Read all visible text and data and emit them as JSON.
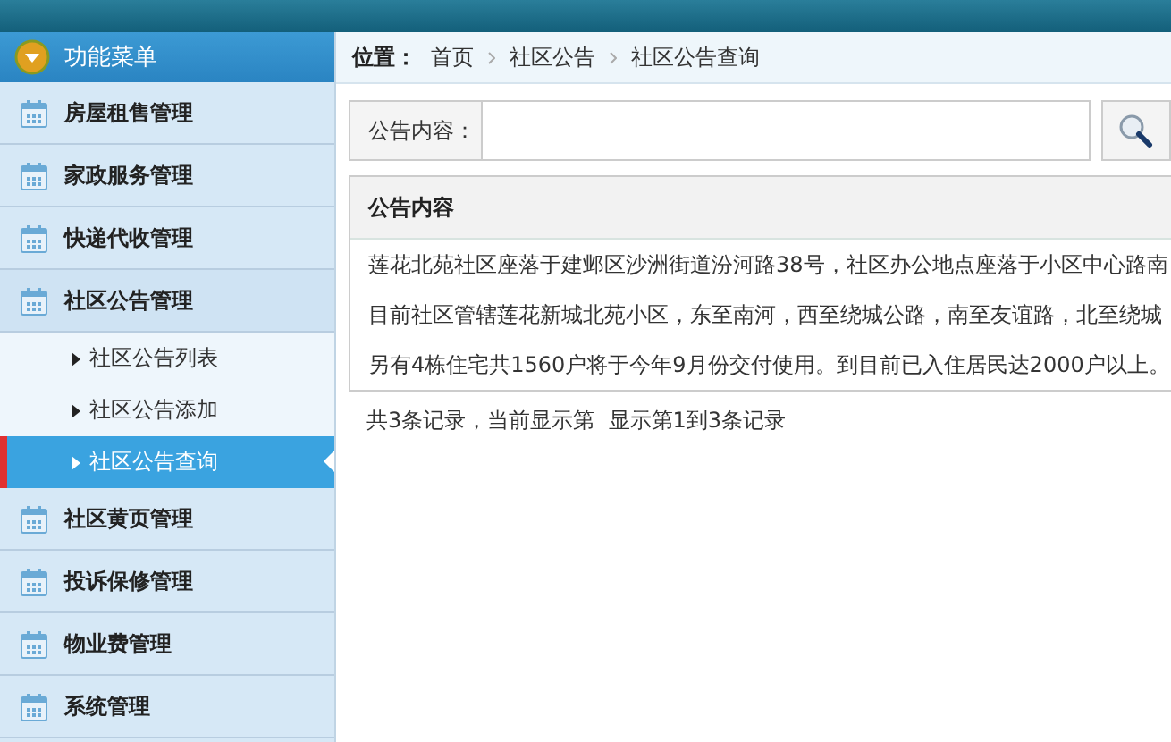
{
  "sidebar": {
    "title": "功能菜单",
    "items": [
      {
        "label": "房屋租售管理"
      },
      {
        "label": "家政服务管理"
      },
      {
        "label": "快递代收管理"
      },
      {
        "label": "社区公告管理",
        "children": [
          {
            "label": "社区公告列表",
            "selected": false
          },
          {
            "label": "社区公告添加",
            "selected": false
          },
          {
            "label": "社区公告查询",
            "selected": true
          }
        ]
      },
      {
        "label": "社区黄页管理"
      },
      {
        "label": "投诉保修管理"
      },
      {
        "label": "物业费管理"
      },
      {
        "label": "系统管理"
      }
    ]
  },
  "breadcrumb": {
    "label": "位置：",
    "items": [
      "首页",
      "社区公告",
      "社区公告查询"
    ]
  },
  "search": {
    "label": "公告内容："
  },
  "table": {
    "columns": [
      "公告内容"
    ],
    "rows": [
      [
        "莲花北苑社区座落于建邺区沙洲街道汾河路38号，社区办公地点座落于小区中心路南"
      ],
      [
        "目前社区管辖莲花新城北苑小区，东至南河，西至绕城公路，南至友谊路，北至绕城"
      ],
      [
        "另有4栋住宅共1560户将于今年9月份交付使用。到目前已入住居民达2000户以上。"
      ]
    ]
  },
  "pager": "共3条记录，当前显示第  显示第1到3条记录"
}
